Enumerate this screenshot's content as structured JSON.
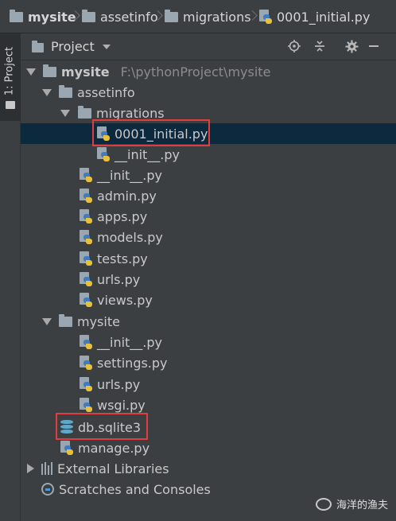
{
  "breadcrumb": {
    "items": [
      "mysite",
      "assetinfo",
      "migrations",
      "0001_initial.py"
    ]
  },
  "tool_stripe": {
    "label": "1: Project"
  },
  "panel": {
    "title": "Project",
    "icons": [
      "locate-icon",
      "collapse-icon",
      "gear-icon",
      "minimize-icon"
    ]
  },
  "tree": {
    "root_name": "mysite",
    "root_path": "F:\\pythonProject\\mysite",
    "assetinfo": "assetinfo",
    "migrations": "migrations",
    "initial": "0001_initial.py",
    "mig_init": "__init__.py",
    "asset_files": [
      "__init__.py",
      "admin.py",
      "apps.py",
      "models.py",
      "tests.py",
      "urls.py",
      "views.py"
    ],
    "mysite_pkg": "mysite",
    "mysite_files": [
      "__init__.py",
      "settings.py",
      "urls.py",
      "wsgi.py"
    ],
    "db": "db.sqlite3",
    "manage": "manage.py",
    "external": "External Libraries",
    "scratches": "Scratches and Consoles"
  },
  "watermark": {
    "text": "海洋的渔夫"
  },
  "colors": {
    "highlight_box": "#e23c3c",
    "selected_row": "#0d293e",
    "background": "#3c3f41"
  }
}
